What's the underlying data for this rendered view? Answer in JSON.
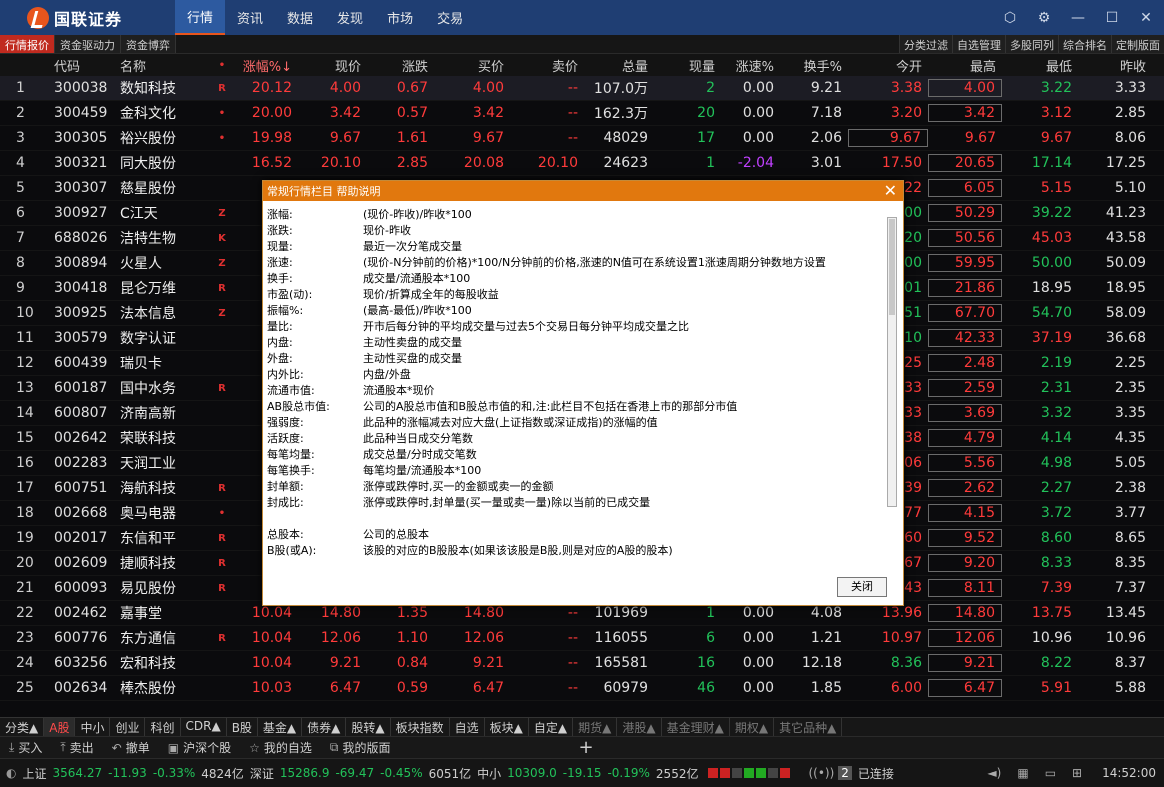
{
  "app": {
    "logo": "国联证券"
  },
  "menu": [
    "行情",
    "资讯",
    "数据",
    "发现",
    "市场",
    "交易"
  ],
  "subtabs": [
    "行情报价",
    "资金驱动力",
    "资金博弈"
  ],
  "right_tools": [
    "分类过滤",
    "自选管理",
    "多股同列",
    "综合排名",
    "定制版面"
  ],
  "headers": [
    "",
    "代码",
    "名称",
    "•",
    "涨幅%↓",
    "现价",
    "涨跌",
    "买价",
    "卖价",
    "总量",
    "现量",
    "涨速%",
    "换手%",
    "今开",
    "最高",
    "最低",
    "昨收"
  ],
  "rows": [
    [
      "1",
      "300038",
      "数知科技",
      "R",
      "20.12",
      "4.00",
      "0.67",
      "4.00",
      "--",
      "107.0万",
      "2",
      "0.00",
      "9.21",
      "3.38",
      "4.00",
      "3.22",
      "3.33"
    ],
    [
      "2",
      "300459",
      "金科文化",
      "•",
      "20.00",
      "3.42",
      "0.57",
      "3.42",
      "--",
      "162.3万",
      "20",
      "0.00",
      "7.18",
      "3.20",
      "3.42",
      "3.12",
      "2.85"
    ],
    [
      "3",
      "300305",
      "裕兴股份",
      "•",
      "19.98",
      "9.67",
      "1.61",
      "9.67",
      "--",
      "48029",
      "17",
      "0.00",
      "2.06",
      "9.67",
      "9.67",
      "9.67",
      "8.06"
    ],
    [
      "4",
      "300321",
      "同大股份",
      "",
      "16.52",
      "20.10",
      "2.85",
      "20.08",
      "20.10",
      "24623",
      "1",
      "-2.04",
      "3.01",
      "17.50",
      "20.65",
      "17.14",
      "17.25"
    ],
    [
      "5",
      "300307",
      "慈星股份",
      "",
      "15",
      "",
      "",
      "",
      "",
      "",
      "",
      "",
      "",
      "22",
      "6.05",
      "5.15",
      "5.10"
    ],
    [
      "6",
      "300927",
      "C江天",
      "Z",
      "",
      "",
      "",
      "",
      "",
      "",
      "",
      "",
      "",
      "00",
      "50.29",
      "39.22",
      "41.23"
    ],
    [
      "7",
      "688026",
      "洁特生物",
      "K",
      "",
      "",
      "",
      "",
      "",
      "",
      "",
      "",
      "",
      "20",
      "50.56",
      "45.03",
      "43.58"
    ],
    [
      "8",
      "300894",
      "火星人",
      "Z",
      "",
      "",
      "",
      "",
      "",
      "",
      "",
      "",
      "",
      "00",
      "59.95",
      "50.00",
      "50.09"
    ],
    [
      "9",
      "300418",
      "昆仑万维",
      "R",
      "1",
      "",
      "",
      "",
      "",
      "",
      "",
      "",
      "",
      "01",
      "21.86",
      "18.95",
      "18.95"
    ],
    [
      "10",
      "300925",
      "法本信息",
      "Z",
      "1",
      "",
      "",
      "",
      "",
      "",
      "",
      "",
      "",
      "51",
      "67.70",
      "54.70",
      "58.09"
    ],
    [
      "11",
      "300579",
      "数字认证",
      "",
      "1",
      "",
      "",
      "",
      "",
      "",
      "",
      "",
      "",
      "10",
      "42.33",
      "37.19",
      "36.68"
    ],
    [
      "12",
      "600439",
      "瑞贝卡",
      "",
      "1",
      "",
      "",
      "",
      "",
      "",
      "",
      "",
      "",
      "25",
      "2.48",
      "2.19",
      "2.25"
    ],
    [
      "13",
      "600187",
      "国中水务",
      "R",
      "1",
      "",
      "",
      "",
      "",
      "",
      "",
      "",
      "",
      "33",
      "2.59",
      "2.31",
      "2.35"
    ],
    [
      "14",
      "600807",
      "济南高新",
      "",
      "1",
      "",
      "",
      "",
      "",
      "",
      "",
      "",
      "",
      "33",
      "3.69",
      "3.32",
      "3.35"
    ],
    [
      "15",
      "002642",
      "荣联科技",
      "",
      "1",
      "",
      "",
      "",
      "",
      "",
      "",
      "",
      "",
      "38",
      "4.79",
      "4.14",
      "4.35"
    ],
    [
      "16",
      "002283",
      "天润工业",
      "",
      "1",
      "",
      "",
      "",
      "",
      "",
      "",
      "",
      "",
      "06",
      "5.56",
      "4.98",
      "5.05"
    ],
    [
      "17",
      "600751",
      "海航科技",
      "R",
      "1",
      "",
      "",
      "",
      "",
      "",
      "",
      "",
      "",
      "39",
      "2.62",
      "2.27",
      "2.38"
    ],
    [
      "18",
      "002668",
      "奥马电器",
      "•",
      "1",
      "",
      "",
      "",
      "",
      "",
      "",
      "",
      "",
      "77",
      "4.15",
      "3.72",
      "3.77"
    ],
    [
      "19",
      "002017",
      "东信和平",
      "R",
      "1",
      "",
      "",
      "",
      "",
      "",
      "",
      "",
      "",
      "60",
      "9.52",
      "8.60",
      "8.65"
    ],
    [
      "20",
      "002609",
      "捷顺科技",
      "R",
      "1",
      "",
      "",
      "",
      "",
      "",
      "",
      "",
      "",
      "67",
      "9.20",
      "8.33",
      "8.35"
    ],
    [
      "21",
      "600093",
      "易见股份",
      "R",
      "1",
      "",
      "",
      "",
      "",
      "",
      "",
      "",
      "",
      "43",
      "8.11",
      "7.39",
      "7.37"
    ],
    [
      "22",
      "002462",
      "嘉事堂",
      "",
      "10.04",
      "14.80",
      "1.35",
      "14.80",
      "--",
      "101969",
      "1",
      "0.00",
      "4.08",
      "13.96",
      "14.80",
      "13.75",
      "13.45"
    ],
    [
      "23",
      "600776",
      "东方通信",
      "R",
      "10.04",
      "12.06",
      "1.10",
      "12.06",
      "--",
      "116055",
      "6",
      "0.00",
      "1.21",
      "10.97",
      "12.06",
      "10.96",
      "10.96"
    ],
    [
      "24",
      "603256",
      "宏和科技",
      "",
      "10.04",
      "9.21",
      "0.84",
      "9.21",
      "--",
      "165581",
      "16",
      "0.00",
      "12.18",
      "8.36",
      "9.21",
      "8.22",
      "8.37"
    ],
    [
      "25",
      "002634",
      "棒杰股份",
      "",
      "10.03",
      "6.47",
      "0.59",
      "6.47",
      "--",
      "60979",
      "46",
      "0.00",
      "1.85",
      "6.00",
      "6.47",
      "5.91",
      "5.88"
    ]
  ],
  "dialog": {
    "title": "常规行情栏目 帮助说明",
    "close_label": "关闭",
    "defs": [
      [
        "涨幅:",
        "(现价-昨收)/昨收*100"
      ],
      [
        "涨跌:",
        "现价-昨收"
      ],
      [
        "现量:",
        "最近一次分笔成交量"
      ],
      [
        "涨速:",
        "(现价-N分钟前的价格)*100/N分钟前的价格,涨速的N值可在系统设置1涨速周期分钟数地方设置"
      ],
      [
        "换手:",
        "成交量/流通股本*100"
      ],
      [
        "市盈(动):",
        "现价/折算成全年的每股收益"
      ],
      [
        "振幅%:",
        "(最高-最低)/昨收*100"
      ],
      [
        "量比:",
        "开市后每分钟的平均成交量与过去5个交易日每分钟平均成交量之比"
      ],
      [
        "内盘:",
        "主动性卖盘的成交量"
      ],
      [
        "外盘:",
        "主动性买盘的成交量"
      ],
      [
        "内外比:",
        "内盘/外盘"
      ],
      [
        "流通市值:",
        "流通股本*现价"
      ],
      [
        "AB股总市值:",
        "公司的A股总市值和B股总市值的和,注:此栏目不包括在香港上市的那部分市值"
      ],
      [
        "强弱度:",
        "此品种的涨幅减去对应大盘(上证指数或深证成指)的涨幅的值"
      ],
      [
        "活跃度:",
        "此品种当日成交分笔数"
      ],
      [
        "每笔均量:",
        "成交总量/分时成交笔数"
      ],
      [
        "每笔换手:",
        "每笔均量/流通股本*100"
      ],
      [
        "封单额:",
        "涨停或跌停时,买一的金额或卖一的金额"
      ],
      [
        "封成比:",
        "涨停或跌停时,封单量(买一量或卖一量)除以当前的已成交量"
      ],
      [
        "",
        ""
      ],
      [
        "总股本:",
        "公司的总股本"
      ],
      [
        "B股(或A):",
        "该股的对应的B股股本(如果该该股是B股,则是对应的A股的股本)"
      ]
    ]
  },
  "categories": [
    "分类▲",
    "A股",
    "中小",
    "创业",
    "科创",
    "CDR▲",
    "B股",
    "基金▲",
    "债券▲",
    "股转▲",
    "板块指数",
    "自选",
    "板块▲",
    "自定▲",
    "期货▲",
    "港股▲",
    "基金理财▲",
    "期权▲",
    "其它品种▲"
  ],
  "actions": [
    "买入",
    "卖出",
    "撤单",
    "沪深个股",
    "我的自选",
    "我的版面"
  ],
  "status": {
    "sh_label": "上证",
    "sh_val": "3564.27",
    "sh_chg": "-11.93",
    "sh_pct": "-0.33%",
    "sh_amt": "4824亿",
    "sz_label": "深证",
    "sz_val": "15286.9",
    "sz_chg": "-69.47",
    "sz_pct": "-0.45%",
    "sz_amt": "6051亿",
    "zx_label": "中小",
    "zx_val": "10309.0",
    "zx_chg": "-19.15",
    "zx_pct": "-0.19%",
    "zx_amt": "2552亿",
    "conn_count": "2",
    "conn": "已连接",
    "time": "14:52:00"
  }
}
